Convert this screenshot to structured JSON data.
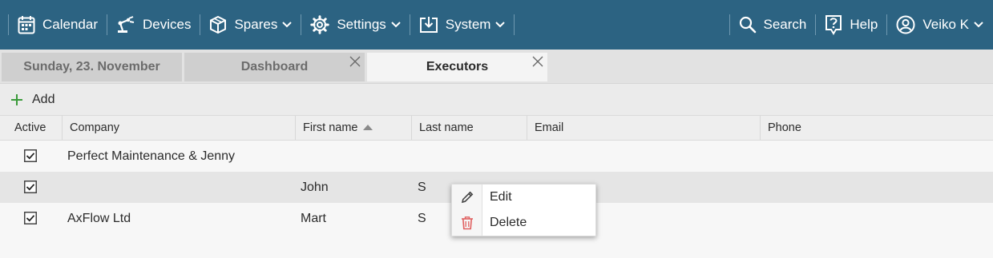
{
  "nav": {
    "calendar": "Calendar",
    "devices": "Devices",
    "spares": "Spares",
    "settings": "Settings",
    "system": "System",
    "search": "Search",
    "help": "Help",
    "user": "Veiko K"
  },
  "tabs": [
    "Sunday, 23. November",
    "Dashboard",
    "Executors"
  ],
  "toolbar": {
    "add_label": "Add"
  },
  "grid": {
    "columns": [
      "Active",
      "Company",
      "First name",
      "Last name",
      "Email",
      "Phone"
    ],
    "sorted_column": "First name",
    "sort_direction": "ascending",
    "rows": [
      {
        "active": true,
        "company": "Perfect Maintenance & Jenny",
        "first_name": "",
        "last_name": "",
        "email": "",
        "phone": ""
      },
      {
        "active": true,
        "company": "",
        "first_name": "John",
        "last_name": "S",
        "email": "",
        "phone": ""
      },
      {
        "active": true,
        "company": "AxFlow Ltd",
        "first_name": "Mart",
        "last_name": "S",
        "email": "",
        "phone": ""
      }
    ]
  },
  "context_menu": {
    "edit": "Edit",
    "delete": "Delete"
  },
  "colors": {
    "header_bg": "#2c6382",
    "add_plus": "#3a9a3a",
    "delete_icon": "#e06060"
  }
}
